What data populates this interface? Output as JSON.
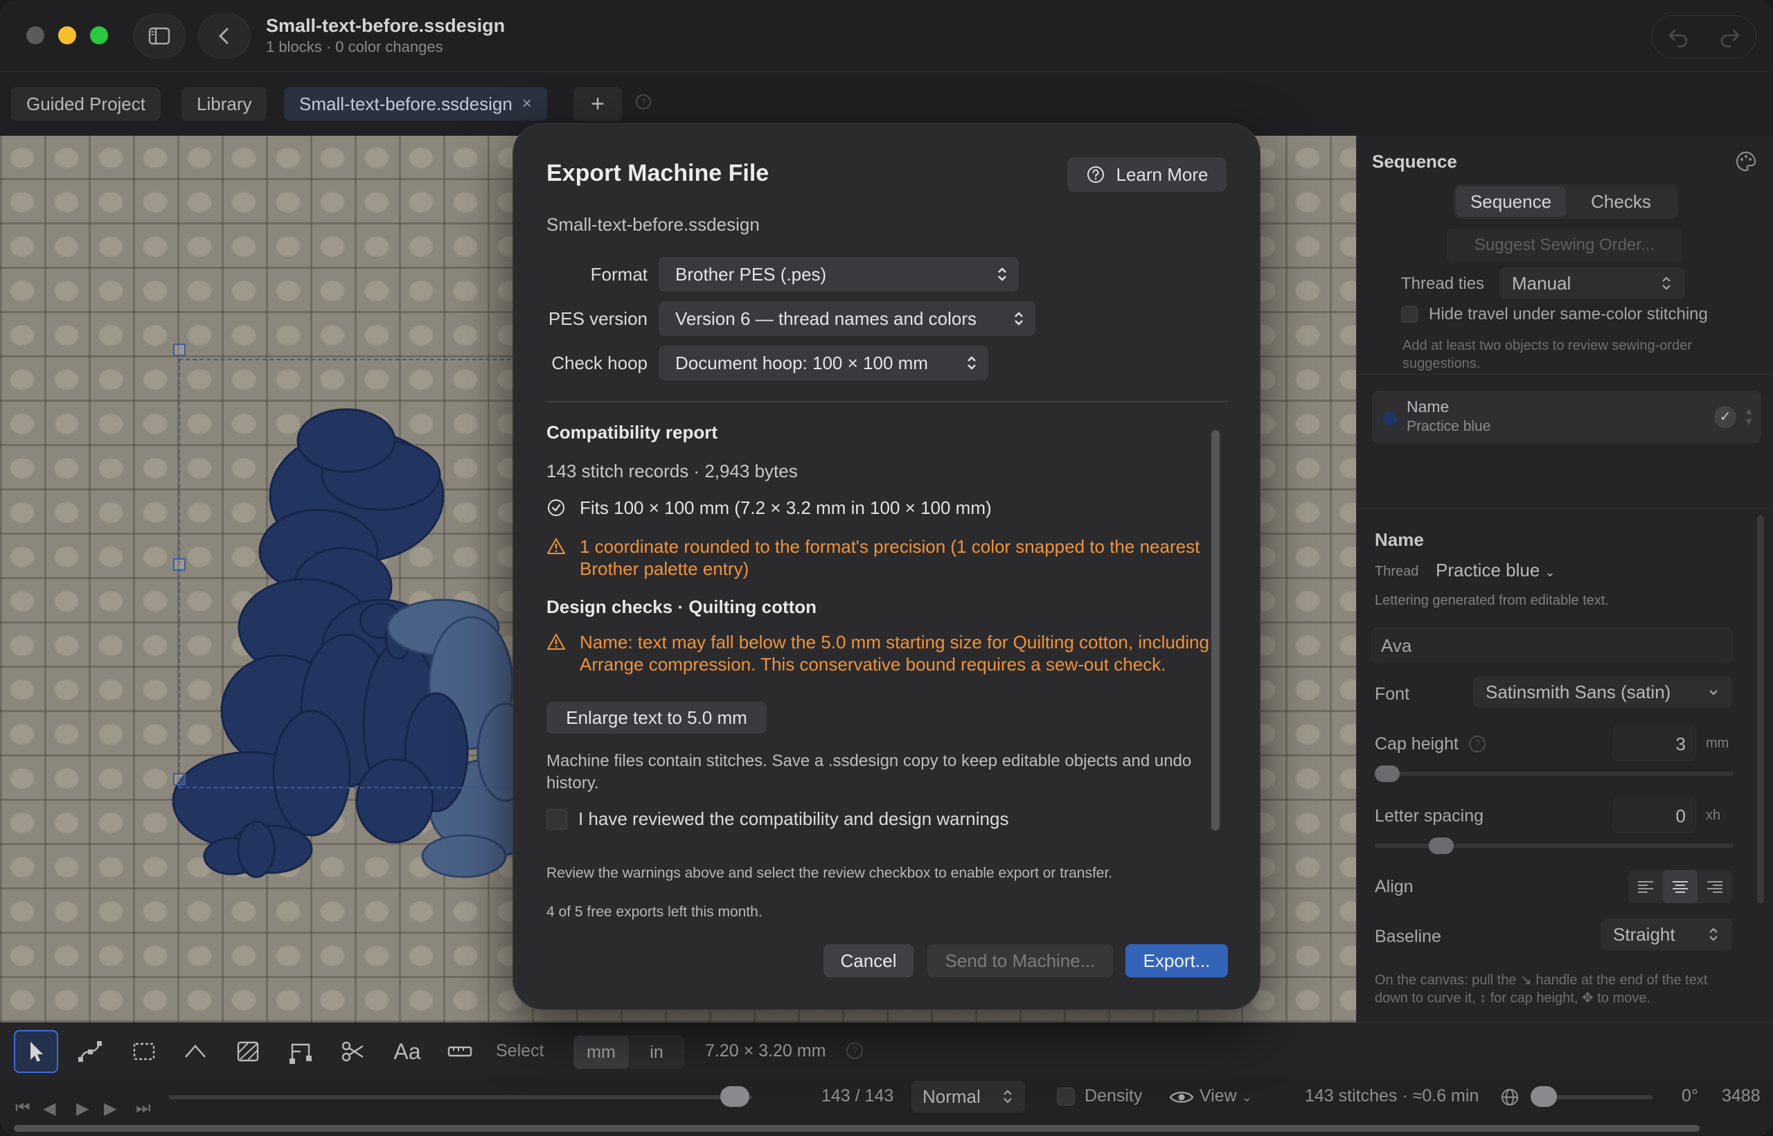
{
  "window": {
    "doc_title": "Small-text-before.ssdesign",
    "doc_subtitle": "1 blocks · 0 color changes"
  },
  "tabs": [
    {
      "label": "Guided Project"
    },
    {
      "label": "Library"
    },
    {
      "label": "Small-text-before.ssdesign",
      "close": "×"
    }
  ],
  "tab_add_label": "+",
  "modal": {
    "title": "Export Machine File",
    "learn_more": "Learn More",
    "filename": "Small-text-before.ssdesign",
    "format_label": "Format",
    "format_value": "Brother PES (.pes)",
    "pes_label": "PES version",
    "pes_value": "Version 6 — thread names and colors",
    "hoop_label": "Check hoop",
    "hoop_value": "Document hoop: 100 × 100 mm",
    "report_title": "Compatibility report",
    "report_stats": "143 stitch records · 2,943 bytes",
    "fits_text": "Fits 100 × 100 mm (7.2 × 3.2 mm in 100 × 100 mm)",
    "rounding_warning": "1 coordinate rounded to the format's precision (1 color snapped to the nearest Brother palette entry)",
    "design_checks_title": "Design checks · Quilting cotton",
    "size_warning": "Name: text may fall below the 5.0 mm starting size for Quilting cotton, including Arrange compression. This conservative bound requires a sew-out check.",
    "enlarge_button": "Enlarge text to 5.0 mm",
    "machine_note": "Machine files contain stitches. Save a .ssdesign copy to keep editable objects and undo history.",
    "review_checkbox_label": "I have reviewed the compatibility and design warnings",
    "review_hint": "Review the warnings above and select the review checkbox to enable export or transfer.",
    "free_exports": "4 of 5 free exports left this month.",
    "cancel": "Cancel",
    "send": "Send to Machine...",
    "export": "Export..."
  },
  "sequence_panel": {
    "title": "Sequence",
    "segments": [
      "Sequence",
      "Checks"
    ],
    "suggest_button": "Suggest Sewing Order...",
    "thread_ties_label": "Thread ties",
    "thread_ties_value": "Manual",
    "hide_travel_label": "Hide travel under same-color stitching",
    "hint": "Add at least two objects to review sewing-order suggestions.",
    "item_name": "Name",
    "item_thread": "Practice blue",
    "item_check": "✓"
  },
  "inspector": {
    "title": "Name",
    "thread_label": "Thread",
    "thread_value": "Practice blue",
    "lettering_note": "Lettering generated from editable text.",
    "text_value": "Ava",
    "font_label": "Font",
    "font_value": "Satinsmith Sans (satin)",
    "cap_height_label": "Cap height",
    "cap_height_value": "3",
    "cap_height_unit": "mm",
    "letter_spacing_label": "Letter spacing",
    "letter_spacing_value": "0",
    "letter_spacing_unit": "xh",
    "align_label": "Align",
    "baseline_label": "Baseline",
    "baseline_value": "Straight",
    "footer_hint": "On the canvas: pull the ↘ handle at the end of the text down to curve it, ↕ for cap height, ✥ to move."
  },
  "toolbar": {
    "text_tool": "Aa",
    "mode_label": "Select",
    "units": [
      "mm",
      "in"
    ],
    "size_readout": "7.20 × 3.20 mm"
  },
  "playback": {
    "counter": "143 / 143",
    "speed": "Normal",
    "density_label": "Density",
    "view_label": "View",
    "stitch_info": "143 stitches · ≈0.6 min",
    "angle": "0°",
    "trailing_value": "3488"
  },
  "colors": {
    "accent": "#3464b8",
    "warning": "#f0923a",
    "stitch_blue": "#1f3566"
  }
}
